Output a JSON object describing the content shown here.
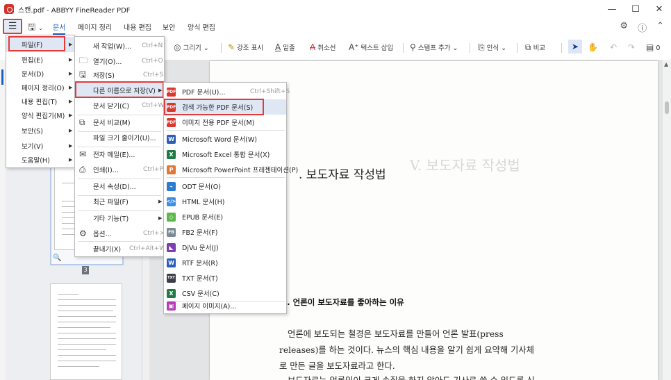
{
  "window": {
    "title": "스캔.pdf - ABBYY FineReader PDF",
    "controls": [
      "—",
      "☐",
      "✕"
    ]
  },
  "tabs": [
    "문서",
    "페이지 정리",
    "내용 편집",
    "보안",
    "양식 편집"
  ],
  "toolbar": {
    "draw": "그리기",
    "highlight": "강조 표시",
    "underline": "밑줄",
    "strikethrough": "취소선",
    "insert_text": "텍스트 삽입",
    "add_stamp": "스탬프 추가",
    "recognize": "인식",
    "compare": "비교",
    "comments_count": "0"
  },
  "main_menu": [
    {
      "label": "파일(F)"
    },
    {
      "label": "편집(E)"
    },
    {
      "label": "문서(D)"
    },
    {
      "label": "페이지 정리(O)"
    },
    {
      "label": "내용 편집(T)"
    },
    {
      "label": "양식 편집기(M)"
    },
    {
      "label": "보안(S)"
    },
    {
      "label": "보기(V)"
    },
    {
      "label": "도움말(H)"
    }
  ],
  "file_menu": [
    {
      "label": "새 작업(W)...",
      "shortcut": "Ctrl+N"
    },
    {
      "label": "열기(O)...",
      "shortcut": "Ctrl+O"
    },
    {
      "label": "저장(S)",
      "shortcut": "Ctrl+S"
    },
    {
      "label": "다른 이름으로 저장(V)",
      "shortcut": ""
    },
    {
      "label": "문서 닫기(C)",
      "shortcut": "Ctrl+W"
    },
    {
      "label": "문서 비교(M)",
      "shortcut": ""
    },
    {
      "label": "파일 크기 줄이기(U)...",
      "shortcut": ""
    },
    {
      "label": "전자 메일(E)...",
      "shortcut": ""
    },
    {
      "label": "인쇄(I)...",
      "shortcut": "Ctrl+P"
    },
    {
      "label": "문서 속성(D)...",
      "shortcut": ""
    },
    {
      "label": "최근 파일(F)",
      "shortcut": ""
    },
    {
      "label": "기타 기능(T)",
      "shortcut": ""
    },
    {
      "label": "옵션...",
      "shortcut": "Ctrl+>"
    },
    {
      "label": "끝내기(X)",
      "shortcut": "Ctrl+Alt+W"
    }
  ],
  "save_as_menu": [
    {
      "label": "PDF 문서(U)...",
      "shortcut": "Ctrl+Shift+S"
    },
    {
      "label": "검색 가능한 PDF 문서(S)",
      "shortcut": ""
    },
    {
      "label": "이미지 전용 PDF 문서(M)",
      "shortcut": ""
    },
    {
      "label": "Microsoft Word 문서(W)",
      "shortcut": ""
    },
    {
      "label": "Microsoft Excel 통합 문서(X)",
      "shortcut": ""
    },
    {
      "label": "Microsoft PowerPoint 프레젠테이션(P)",
      "shortcut": ""
    },
    {
      "label": "ODT 문서(O)",
      "shortcut": ""
    },
    {
      "label": "HTML 문서(H)",
      "shortcut": ""
    },
    {
      "label": "EPUB 문서(E)",
      "shortcut": ""
    },
    {
      "label": "FB2 문서(F)",
      "shortcut": ""
    },
    {
      "label": "DjVu 문서(J)",
      "shortcut": ""
    },
    {
      "label": "RTF 문서(R)",
      "shortcut": ""
    },
    {
      "label": "TXT 문서(T)",
      "shortcut": ""
    },
    {
      "label": "CSV 문서(C)",
      "shortcut": ""
    },
    {
      "label": "페이지 이미지(A)...",
      "shortcut": ""
    }
  ],
  "thumbnail": {
    "page_number": "3"
  },
  "document": {
    "heading": ". 보도자료 작성법",
    "ghost_heading": "V. 보도자료 작성법",
    "subheading": "). 언론이 보도자료를 좋아하는 이유",
    "body_lines": [
      "언론에 보도되는 철경은 보도자료를 만들어 언론 발표(press",
      "releases)를 하는 것이다. 뉴스의 핵심 내용을 알기 쉽게 요약해 기사체",
      "로 만든 글을 보도자료라고 한다.",
      "보도자료는 언론인이 크게 손질을 하지 않아도 기사로 쓸 수 있도록 신"
    ]
  }
}
